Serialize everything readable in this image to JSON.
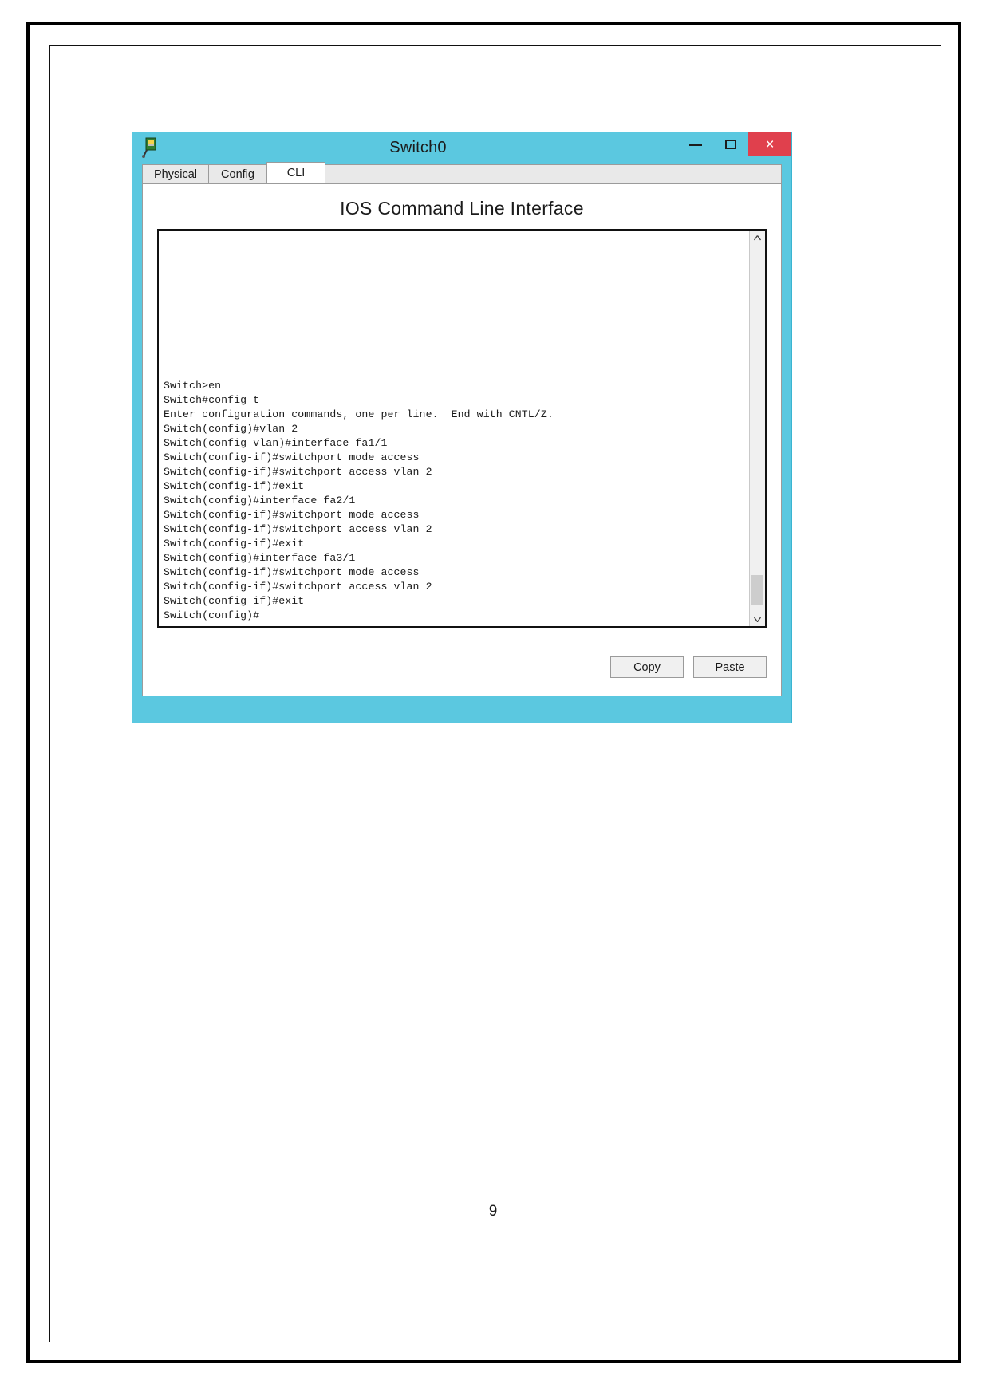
{
  "document": {
    "page_number": "9"
  },
  "window": {
    "title": "Switch0",
    "icon": "packet-tracer-switch-icon",
    "controls": {
      "minimize": "–",
      "maximize": "□",
      "close": "×"
    },
    "close_color": "#e0404d",
    "titlebar_color": "#5bc8e0"
  },
  "tabs": [
    {
      "label": "Physical",
      "active": false
    },
    {
      "label": "Config",
      "active": false
    },
    {
      "label": "CLI",
      "active": true
    }
  ],
  "panel": {
    "heading": "IOS Command Line Interface",
    "terminal_lines": [
      "Switch>en",
      "Switch#config t",
      "Enter configuration commands, one per line.  End with CNTL/Z.",
      "Switch(config)#vlan 2",
      "Switch(config-vlan)#interface fa1/1",
      "Switch(config-if)#switchport mode access",
      "Switch(config-if)#switchport access vlan 2",
      "Switch(config-if)#exit",
      "Switch(config)#interface fa2/1",
      "Switch(config-if)#switchport mode access",
      "Switch(config-if)#switchport access vlan 2",
      "Switch(config-if)#exit",
      "Switch(config)#interface fa3/1",
      "Switch(config-if)#switchport mode access",
      "Switch(config-if)#switchport access vlan 2",
      "Switch(config-if)#exit",
      "Switch(config)#"
    ],
    "scrollbar": {
      "up_arrow": "⌃",
      "down_arrow": "⌄"
    },
    "buttons": {
      "copy": "Copy",
      "paste": "Paste"
    }
  }
}
